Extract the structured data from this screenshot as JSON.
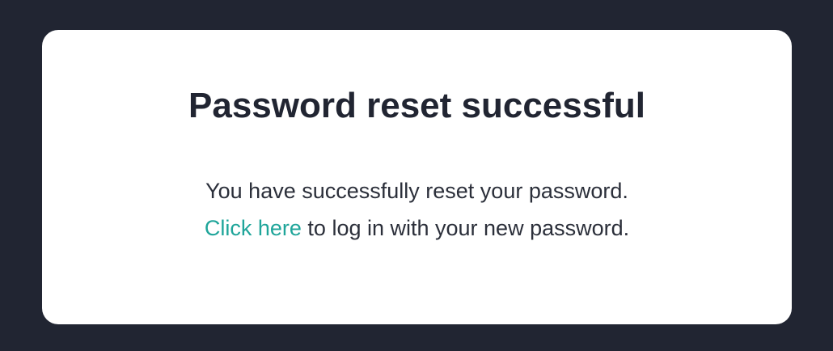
{
  "card": {
    "title": "Password reset successful",
    "message_line1": "You have successfully reset your password.",
    "link_text": "Click here",
    "message_line2_rest": " to log in with your new password."
  },
  "colors": {
    "background": "#212532",
    "card": "#ffffff",
    "heading": "#212532",
    "body_text": "#2b2f3a",
    "link": "#1fa59a"
  }
}
